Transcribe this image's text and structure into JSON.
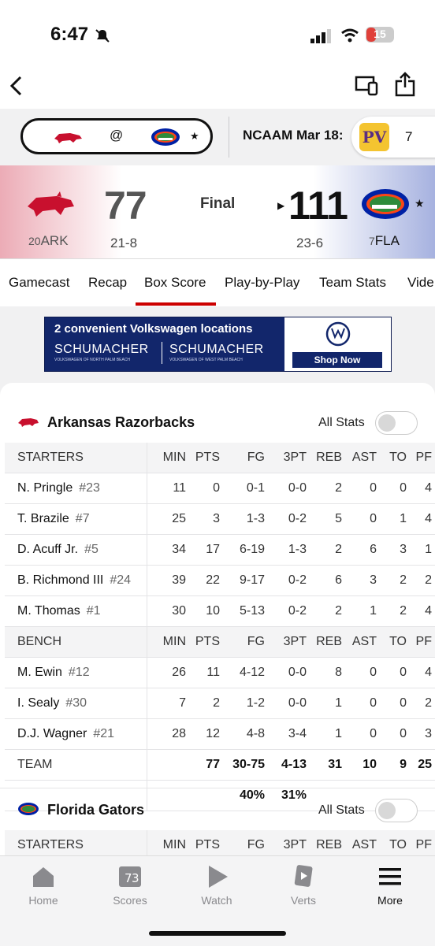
{
  "status_bar": {
    "time": "6:47",
    "battery": "15"
  },
  "score_strip": {
    "at": "@",
    "league_date": "NCAAM Mar 18:",
    "other_score": "7",
    "other_team_logo": "PVAMU"
  },
  "game": {
    "status": "Final",
    "away": {
      "rank": "20",
      "abbr": "ARK",
      "score": "77",
      "record": "21-8"
    },
    "home": {
      "rank": "7",
      "abbr": "FLA",
      "score": "111",
      "record": "23-6"
    }
  },
  "tabs": [
    "Gamecast",
    "Recap",
    "Box Score",
    "Play-by-Play",
    "Team Stats",
    "Vide"
  ],
  "active_tab": "Box Score",
  "ad": {
    "headline": "2 convenient Volkswagen locations",
    "brand1": "SCHUMACHER",
    "sub1": "VOLKSWAGEN OF NORTH PALM BEACH",
    "brand2": "SCHUMACHER",
    "sub2": "VOLKSWAGEN OF WEST PALM BEACH",
    "cta": "Shop Now"
  },
  "boxscore": {
    "all_stats_label": "All Stats",
    "columns": [
      "MIN",
      "PTS",
      "FG",
      "3PT",
      "REB",
      "AST",
      "TO",
      "PF"
    ],
    "team1": {
      "name": "Arkansas Razorbacks",
      "starters_label": "STARTERS",
      "starters": [
        {
          "name": "N. Pringle",
          "jersey": "#23",
          "stats": [
            "11",
            "0",
            "0-1",
            "0-0",
            "2",
            "0",
            "0",
            "4"
          ]
        },
        {
          "name": "T. Brazile",
          "jersey": "#7",
          "stats": [
            "25",
            "3",
            "1-3",
            "0-2",
            "5",
            "0",
            "1",
            "4"
          ]
        },
        {
          "name": "D. Acuff Jr.",
          "jersey": "#5",
          "stats": [
            "34",
            "17",
            "6-19",
            "1-3",
            "2",
            "6",
            "3",
            "1"
          ]
        },
        {
          "name": "B. Richmond III",
          "jersey": "#24",
          "stats": [
            "39",
            "22",
            "9-17",
            "0-2",
            "6",
            "3",
            "2",
            "2"
          ]
        },
        {
          "name": "M. Thomas",
          "jersey": "#1",
          "stats": [
            "30",
            "10",
            "5-13",
            "0-2",
            "2",
            "1",
            "2",
            "4"
          ]
        }
      ],
      "bench_label": "BENCH",
      "bench": [
        {
          "name": "M. Ewin",
          "jersey": "#12",
          "stats": [
            "26",
            "11",
            "4-12",
            "0-0",
            "8",
            "0",
            "0",
            "4"
          ]
        },
        {
          "name": "I. Sealy",
          "jersey": "#30",
          "stats": [
            "7",
            "2",
            "1-2",
            "0-0",
            "1",
            "0",
            "0",
            "2"
          ]
        },
        {
          "name": "D.J. Wagner",
          "jersey": "#21",
          "stats": [
            "28",
            "12",
            "4-8",
            "3-4",
            "1",
            "0",
            "0",
            "3"
          ]
        }
      ],
      "team_label": "TEAM",
      "team_totals": [
        "",
        "77",
        "30-75",
        "4-13",
        "31",
        "10",
        "9",
        "25"
      ],
      "team_pct": [
        "",
        "",
        "40%",
        "31%",
        "",
        "",
        "",
        ""
      ]
    },
    "team2": {
      "name": "Florida Gators",
      "starters_label": "STARTERS"
    }
  },
  "bottom_nav": [
    "Home",
    "Scores",
    "Watch",
    "Verts",
    "More"
  ],
  "colors": {
    "accent": "#cc0000",
    "ark_red": "#c8102e",
    "fla_blue": "#0021a5",
    "fla_orange": "#fa4616"
  }
}
